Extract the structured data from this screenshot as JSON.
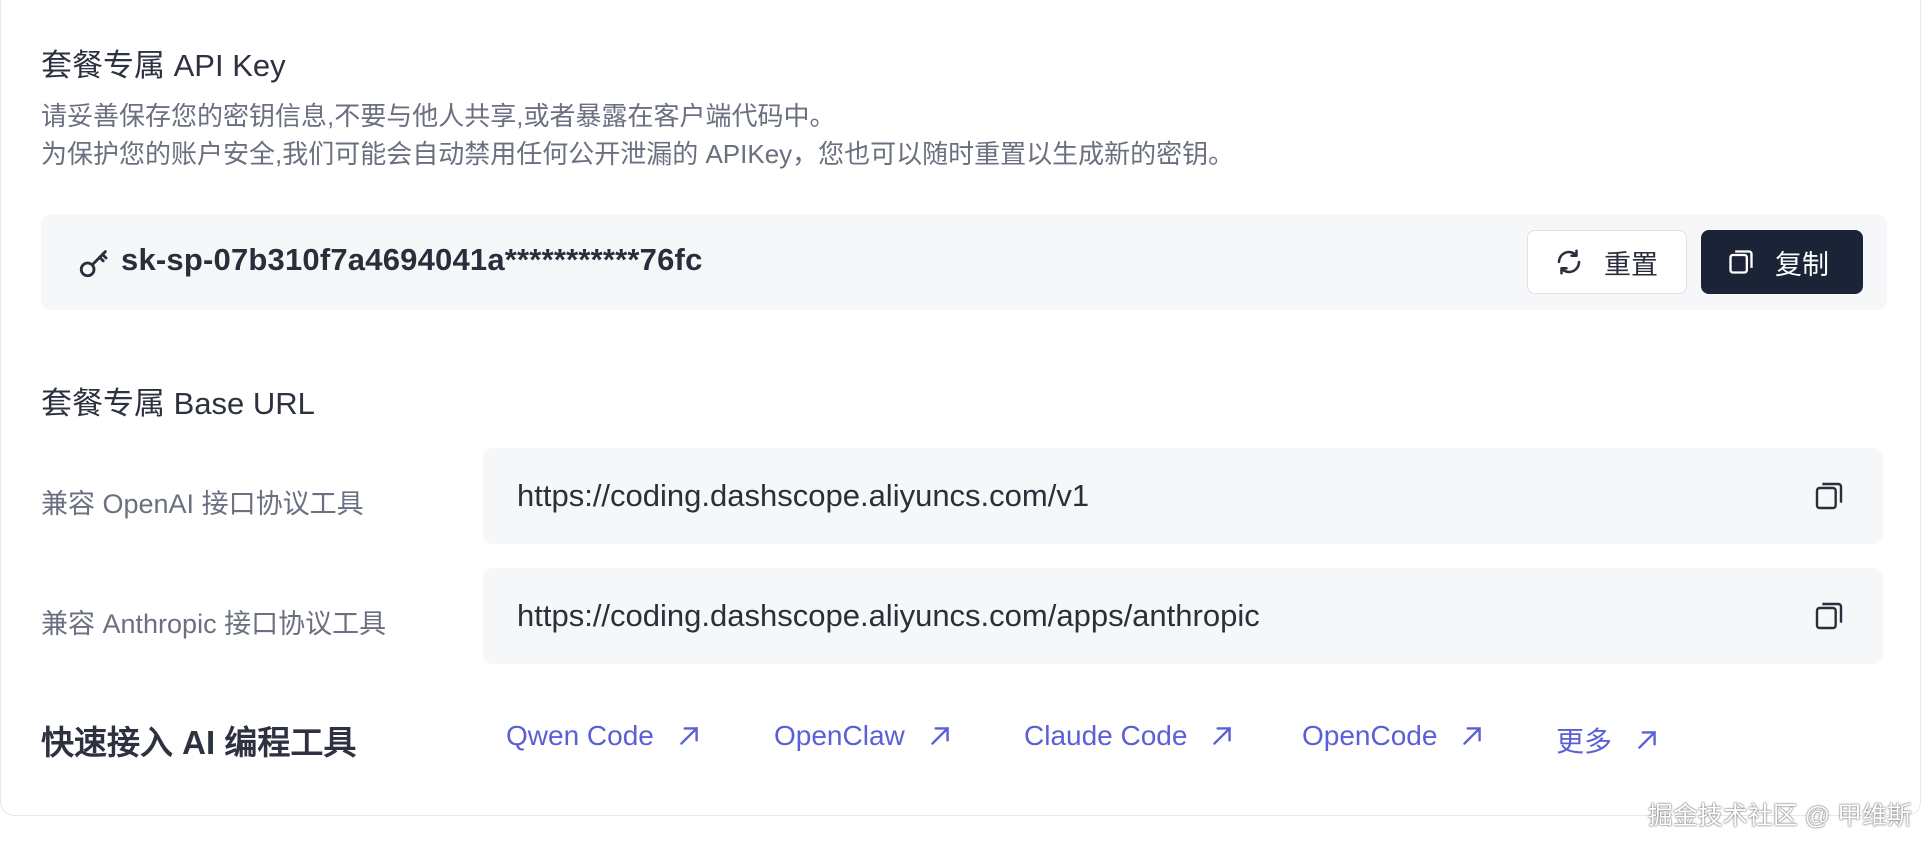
{
  "api_key_section": {
    "title": "套餐专属 API Key",
    "desc_line1": "请妥善保存您的密钥信息,不要与他人共享,或者暴露在客户端代码中。",
    "desc_line2": "为保护您的账户安全,我们可能会自动禁用任何公开泄漏的 APIKey，您也可以随时重置以生成新的密钥。",
    "key_value": "sk-sp-07b310f7a4694041a***********76fc",
    "reset_label": "重置",
    "copy_label": "复制"
  },
  "base_url_section": {
    "title": "套餐专属 Base URL",
    "rows": [
      {
        "label": "兼容 OpenAI 接口协议工具",
        "url": "https://coding.dashscope.aliyuncs.com/v1"
      },
      {
        "label": "兼容 Anthropic 接口协议工具",
        "url": "https://coding.dashscope.aliyuncs.com/apps/anthropic"
      }
    ]
  },
  "quick_access": {
    "title": "快速接入 AI 编程工具",
    "links": [
      {
        "label": "Qwen Code"
      },
      {
        "label": "OpenClaw"
      },
      {
        "label": "Claude Code"
      },
      {
        "label": "OpenCode"
      },
      {
        "label": "更多"
      }
    ]
  },
  "watermark": "掘金技术社区 @ 甲维斯",
  "colors": {
    "primary_button": "#1b2336",
    "link": "#5b5fd6",
    "box_bg": "#f6f7f9"
  },
  "icons": {
    "key": "key-icon",
    "reset": "refresh-icon",
    "copy": "copy-icon",
    "external": "arrow-up-right-icon"
  }
}
